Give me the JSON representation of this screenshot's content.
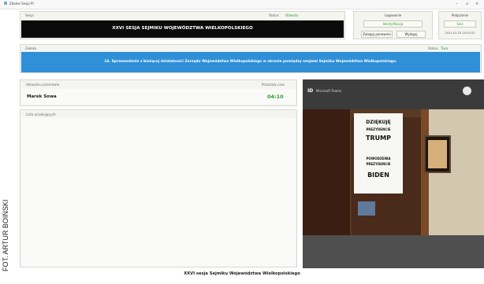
{
  "window": {
    "title": "Zdalne Sesja PI"
  },
  "session_panel": {
    "label": "Sesja",
    "status_label": "Status",
    "status_value": "Otwarta",
    "title": "XXVI SESJA SEJMIKU WOJEWÓDZTWA WIELKOPOLSKIEGO"
  },
  "login_panel": {
    "label": "Logowanie",
    "identification": "Identyfikacja",
    "request_button": "Zaloguj ponownie",
    "logout_button": "Wyloguj"
  },
  "connection_panel": {
    "label": "Połączenie",
    "value": "Sieć",
    "datetime": "2021-01-23 10:53:22"
  },
  "agenda_panel": {
    "label": "Zwłoka",
    "status_label": "Status",
    "status_value": "Trwa",
    "item": "14. Sprawozdanie z bieżącej działalności Zarządu Województwa Wielkopolskiego w okresie pomiędzy sesjami Sejmiku Województwa Wielkopolskiego."
  },
  "speaker_panel": {
    "label": "Aktualnie przemawia",
    "time_label": "Pozostały czas",
    "speaker_name": "Marek Sowa",
    "time_left": "04:10"
  },
  "queue_panel": {
    "label": "Lista oczekujących"
  },
  "video": {
    "app_label": "Microsoft Teams",
    "sign_lines": [
      "DZIĘKUJĘ",
      "PREZYDENCIE",
      "TRUMP",
      "POWODZENIA",
      "PREZYDENCIE",
      "BIDEN"
    ]
  },
  "footer": {
    "caption": "XXVI sesja Sejmiku Województwa Wielkopolskiego"
  },
  "credit": "FOT. ARTUR BOIŃSKI",
  "colors": {
    "accent_blue": "#2f8fd7",
    "banner_black": "#0b0b0b",
    "green": "#2a9d2a"
  }
}
